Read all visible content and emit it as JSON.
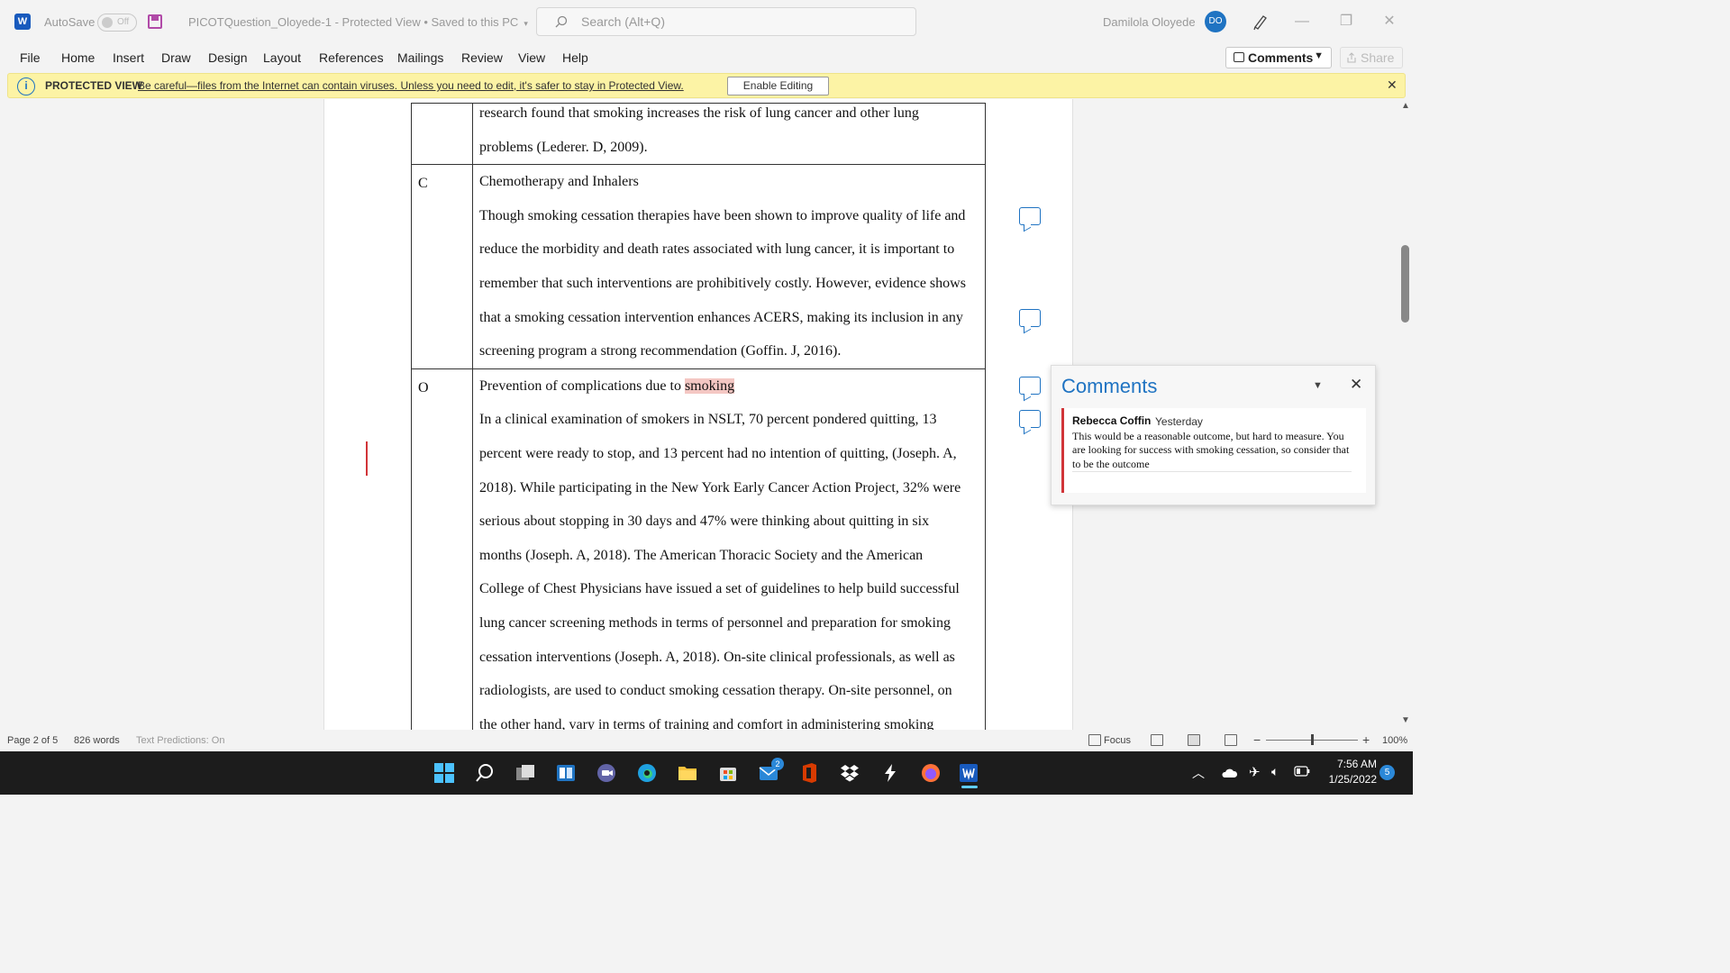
{
  "titlebar": {
    "app_logo": "W",
    "autosave_label": "AutoSave",
    "autosave_state": "Off",
    "doc_title": "PICOTQuestion_Oloyede-1  -  Protected View • Saved to this PC",
    "search_placeholder": "Search (Alt+Q)",
    "user_name": "Damilola  Oloyede",
    "user_initials": "DO"
  },
  "ribbon": {
    "tabs": [
      "File",
      "Home",
      "Insert",
      "Draw",
      "Design",
      "Layout",
      "References",
      "Mailings",
      "Review",
      "View",
      "Help"
    ],
    "comments_label": "Comments",
    "share_label": "Share"
  },
  "protected_view": {
    "title": "PROTECTED VIEW",
    "message": "Be careful—files from the Internet can contain viruses. Unless you need to edit, it's safer to stay in Protected View.",
    "enable_label": "Enable Editing"
  },
  "document": {
    "rows": [
      {
        "key": "",
        "paragraphs": [
          "research found that smoking increases the risk of lung cancer and other lung",
          "problems (Lederer. D, 2009)."
        ]
      },
      {
        "key": "C",
        "paragraphs": [
          "Chemotherapy and Inhalers",
          "Though smoking cessation therapies have been shown to improve quality of life and",
          "reduce the morbidity and death rates associated with lung cancer, it is important to",
          "remember that such interventions are prohibitively costly. However, evidence shows",
          "that a smoking cessation intervention enhances ACERS, making its inclusion in any",
          "screening program a strong recommendation (Goffin. J, 2016)."
        ]
      },
      {
        "key": "O",
        "heading_prefix": "Prevention of complications due to ",
        "heading_highlight": "smoking",
        "paragraphs": [
          "In a clinical examination of smokers in NSLT, 70 percent pondered quitting, 13",
          "percent were ready to stop, and 13 percent had no intention of quitting, (Joseph. A,",
          "2018). While participating in the New York Early Cancer Action Project, 32% were",
          "serious about stopping in 30 days and 47% were thinking about quitting in six",
          "months (Joseph. A, 2018). The American Thoracic Society and the American",
          "College of Chest Physicians have issued a set of guidelines to help build successful",
          "lung cancer screening methods in terms of personnel and preparation for smoking",
          "cessation interventions (Joseph. A, 2018). On-site clinical professionals, as well as",
          "radiologists, are used to conduct smoking cessation therapy. On-site personnel, on",
          "the other hand, vary in terms of training and comfort in administering smoking"
        ]
      }
    ]
  },
  "comments_pane": {
    "title": "Comments",
    "comment": {
      "author": "Rebecca Coffin",
      "time": "Yesterday",
      "text": "This would be a reasonable outcome, but hard to measure. You are looking for success with smoking cessation, so consider that to be the outcome"
    }
  },
  "statusbar": {
    "page": "Page 2 of 5",
    "words": "826 words",
    "predictions": "Text Predictions: On",
    "focus": "Focus",
    "zoom": "100%"
  },
  "taskbar": {
    "mail_badge": "2",
    "time": "7:56 AM",
    "date": "1/25/2022",
    "notifications": "5"
  },
  "colors": {
    "word_blue": "#185abd",
    "accent": "#1f73c2",
    "protected_bar": "#fcf3a5",
    "comment_red": "#d13438",
    "highlight": "#f4c7c3"
  }
}
